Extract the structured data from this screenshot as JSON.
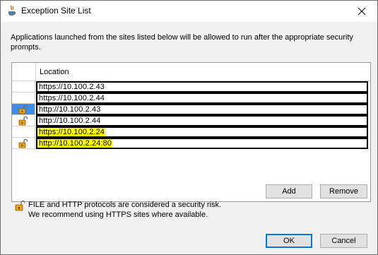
{
  "window": {
    "title": "Exception Site List"
  },
  "intro": {
    "text": "Applications launched from the sites listed below will be allowed to run after the appropriate security prompts."
  },
  "table": {
    "column_header": "Location",
    "rows": [
      {
        "location": "https://10.100.2.43",
        "lock": false,
        "selected": false,
        "highlighted": false
      },
      {
        "location": "https://10.100.2.44",
        "lock": false,
        "selected": false,
        "highlighted": false
      },
      {
        "location": "http://10.100.2.43",
        "lock": true,
        "selected": true,
        "highlighted": false
      },
      {
        "location": "http://10.100.2.44",
        "lock": true,
        "selected": false,
        "highlighted": false
      },
      {
        "location": "https://10.100.2.24",
        "lock": false,
        "selected": false,
        "highlighted": true
      },
      {
        "location": "http://10.100.2.24:80",
        "lock": true,
        "selected": false,
        "highlighted": true
      }
    ]
  },
  "buttons": {
    "add": "Add",
    "remove": "Remove",
    "ok": "OK",
    "cancel": "Cancel"
  },
  "warning": {
    "line1": "FILE and HTTP protocols are considered a security risk.",
    "line2": "We recommend using HTTPS sites where available."
  },
  "colors": {
    "selection": "#3d8ee8",
    "highlight": "#ffff00",
    "default_button_border": "#0078d7"
  },
  "icons": {
    "title": "java-icon",
    "close": "close-icon",
    "lock": "open-lock-icon"
  }
}
